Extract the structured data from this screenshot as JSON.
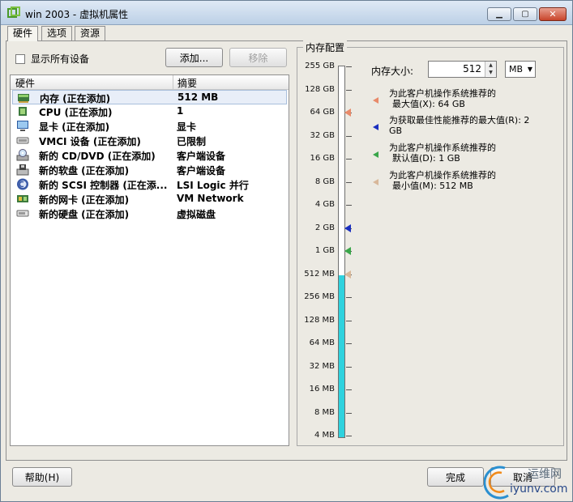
{
  "window": {
    "title": "win 2003 - 虚拟机属性"
  },
  "tabs": [
    "硬件",
    "选项",
    "资源"
  ],
  "left": {
    "show_all_devices": "显示所有设备",
    "add_button": "添加...",
    "remove_button": "移除",
    "columns": {
      "hardware": "硬件",
      "summary": "摘要"
    },
    "devices": [
      {
        "name": "内存 (正在添加)",
        "summary": "512 MB",
        "icon": "memory-icon"
      },
      {
        "name": "CPU (正在添加)",
        "summary": "1",
        "icon": "cpu-icon"
      },
      {
        "name": "显卡 (正在添加)",
        "summary": "显卡",
        "icon": "display-icon"
      },
      {
        "name": "VMCI 设备 (正在添加)",
        "summary": "已限制",
        "icon": "vmci-icon"
      },
      {
        "name": "新的 CD/DVD (正在添加)",
        "summary": "客户端设备",
        "icon": "cdrom-icon"
      },
      {
        "name": "新的软盘 (正在添加)",
        "summary": "客户端设备",
        "icon": "floppy-icon"
      },
      {
        "name": "新的 SCSI 控制器 (正在添...",
        "summary": "LSI Logic 并行",
        "icon": "scsi-icon"
      },
      {
        "name": "新的网卡 (正在添加)",
        "summary": "VM Network",
        "icon": "nic-icon"
      },
      {
        "name": "新的硬盘 (正在添加)",
        "summary": "虚拟磁盘",
        "icon": "disk-icon"
      }
    ]
  },
  "memory": {
    "group_title": "内存配置",
    "size_label": "内存大小:",
    "size_value": "512",
    "unit": "MB",
    "scale_labels": [
      "255 GB",
      "128 GB",
      "64 GB",
      "32 GB",
      "16 GB",
      "8 GB",
      "4 GB",
      "2 GB",
      "1 GB",
      "512 MB",
      "256 MB",
      "128 MB",
      "64 MB",
      "32 MB",
      "16 MB",
      "8 MB",
      "4 MB"
    ],
    "current_index": 9,
    "markers": [
      {
        "index": 2,
        "color": "#e88a6a"
      },
      {
        "index": 7,
        "color": "#1a2fbf"
      },
      {
        "index": 8,
        "color": "#3aa64a"
      },
      {
        "index": 9,
        "color": "#d8b89a"
      }
    ],
    "recommendations": [
      {
        "line1": "为此客户机操作系统推荐的",
        "line2": "最大值(X): 64 GB",
        "color": "#e88a6a"
      },
      {
        "line1": "为获取最佳性能推荐的最大值(R): 2",
        "line2": "GB",
        "color": "#1a2fbf"
      },
      {
        "line1": "为此客户机操作系统推荐的",
        "line2": "默认值(D): 1 GB",
        "color": "#3aa64a"
      },
      {
        "line1": "为此客户机操作系统推荐的",
        "line2": "最小值(M): 512 MB",
        "color": "#d8b89a"
      }
    ]
  },
  "bottom": {
    "help": "帮助(H)",
    "finish": "完成",
    "cancel": "取消"
  },
  "watermark": {
    "text": "运维网",
    "url_text": "iyunv.com"
  }
}
